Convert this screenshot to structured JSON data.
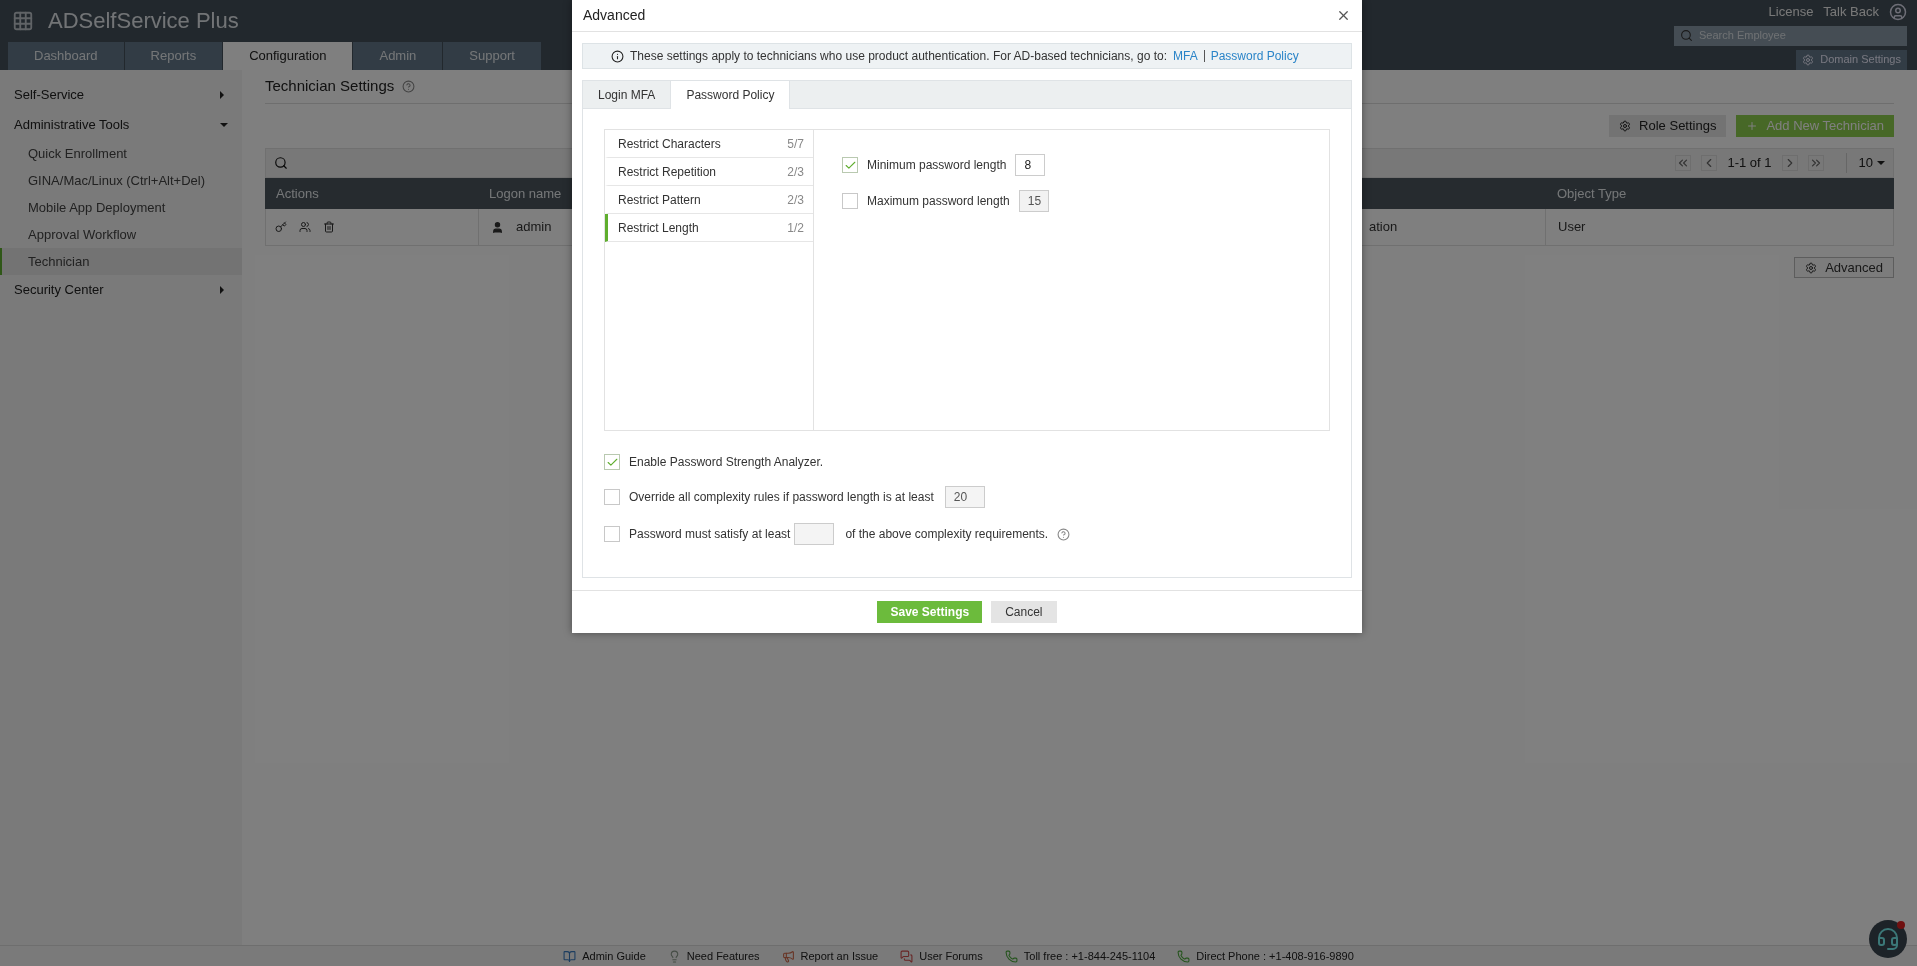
{
  "header": {
    "app_name": "ADSelfService Plus",
    "links": [
      "License",
      "Talk Back"
    ],
    "search": {
      "placeholder": "Search Employee"
    },
    "domain_settings": "Domain Settings"
  },
  "nav_tabs": [
    {
      "label": "Dashboard",
      "selected": false
    },
    {
      "label": "Reports",
      "selected": false
    },
    {
      "label": "Configuration",
      "selected": true
    },
    {
      "label": "Admin",
      "selected": false
    },
    {
      "label": "Support",
      "selected": false
    }
  ],
  "sidebar": {
    "items": [
      {
        "label": "Self-Service",
        "expanded": false
      },
      {
        "label": "Administrative Tools",
        "expanded": true,
        "children": [
          {
            "label": "Quick Enrollment",
            "selected": false
          },
          {
            "label": "GINA/Mac/Linux (Ctrl+Alt+Del)",
            "selected": false
          },
          {
            "label": "Mobile App Deployment",
            "selected": false
          },
          {
            "label": "Approval Workflow",
            "selected": false
          },
          {
            "label": "Technician",
            "selected": true
          }
        ]
      },
      {
        "label": "Security Center",
        "expanded": false
      }
    ]
  },
  "page": {
    "title": "Technician Settings",
    "buttons": [
      {
        "kind": "secondary",
        "label": "Role Settings"
      },
      {
        "kind": "primary",
        "label": "Add New Technician"
      }
    ],
    "pagination": {
      "range": "1-1 of 1",
      "page_size": "10"
    },
    "table": {
      "columns": {
        "actions": "Actions",
        "logon_name": "Logon name",
        "object_type": "Object Type"
      },
      "rows": [
        {
          "logon_name": "admin",
          "column_3": "ation",
          "object_type": "User"
        }
      ]
    },
    "advanced_button": "Advanced"
  },
  "footer": [
    {
      "kind": "guide",
      "label": "Admin Guide"
    },
    {
      "kind": "idea",
      "label": "Need Features"
    },
    {
      "kind": "issue",
      "label": "Report an Issue"
    },
    {
      "kind": "forum",
      "label": "User Forums"
    },
    {
      "kind": "phone",
      "label": "Toll free : +1-844-245-1104"
    },
    {
      "kind": "phone",
      "label": "Direct Phone : +1-408-916-9890"
    }
  ],
  "dialog": {
    "title": "Advanced",
    "notice": {
      "text": "These settings apply to technicians who use product authentication. For AD-based technicians, go to:",
      "links": [
        "MFA",
        "Password Policy"
      ]
    },
    "tabs": [
      {
        "label": "Login MFA",
        "selected": false
      },
      {
        "label": "Password Policy",
        "selected": true
      }
    ],
    "categories": [
      {
        "label": "Restrict Characters",
        "count": "5/7",
        "selected": false
      },
      {
        "label": "Restrict Repetition",
        "count": "2/3",
        "selected": false
      },
      {
        "label": "Restrict Pattern",
        "count": "2/3",
        "selected": false
      },
      {
        "label": "Restrict Length",
        "count": "1/2",
        "selected": true
      }
    ],
    "length_rules": [
      {
        "label": "Minimum password length",
        "value": "8",
        "checked": true
      },
      {
        "label": "Maximum password length",
        "value": "15",
        "checked": false
      }
    ],
    "options": [
      {
        "kind": "plain",
        "label": "Enable Password Strength Analyzer.",
        "checked": true
      },
      {
        "kind": "value_after",
        "label": "Override all complexity rules if password length is at least",
        "value": "20",
        "checked": false
      },
      {
        "kind": "value_inside",
        "label": "Password must satisfy at least",
        "label_after": "of the above complexity requirements.",
        "checked": false
      }
    ],
    "buttons": [
      {
        "kind": "primary",
        "label": "Save Settings"
      },
      {
        "kind": "secondary",
        "label": "Cancel"
      }
    ]
  }
}
